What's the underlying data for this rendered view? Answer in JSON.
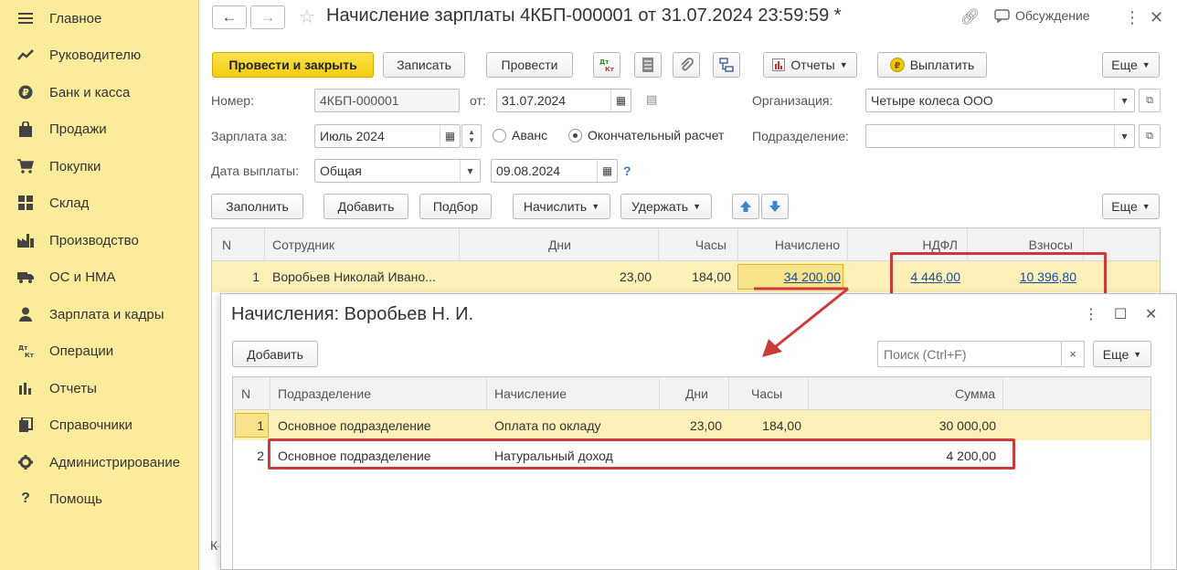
{
  "sidebar": {
    "items": [
      {
        "label": "Главное",
        "icon": "menu-icon"
      },
      {
        "label": "Руководителю",
        "icon": "trend-icon"
      },
      {
        "label": "Банк и касса",
        "icon": "ruble-coin-icon"
      },
      {
        "label": "Продажи",
        "icon": "shopping-bag-icon"
      },
      {
        "label": "Покупки",
        "icon": "cart-icon"
      },
      {
        "label": "Склад",
        "icon": "warehouse-icon"
      },
      {
        "label": "Производство",
        "icon": "factory-icon"
      },
      {
        "label": "ОС и НМА",
        "icon": "truck-icon"
      },
      {
        "label": "Зарплата и кадры",
        "icon": "person-icon"
      },
      {
        "label": "Операции",
        "icon": "dt-kt-icon"
      },
      {
        "label": "Отчеты",
        "icon": "bar-chart-icon"
      },
      {
        "label": "Справочники",
        "icon": "books-icon"
      },
      {
        "label": "Администрирование",
        "icon": "gear-icon"
      },
      {
        "label": "Помощь",
        "icon": "question-icon"
      }
    ]
  },
  "header": {
    "title": "Начисление зарплаты 4КБП-000001 от 31.07.2024 23:59:59 *",
    "discussion": "Обсуждение"
  },
  "toolbar": {
    "post_close": "Провести и закрыть",
    "save": "Записать",
    "post": "Провести",
    "dtkt": "Дт\nКт",
    "reports": "Отчеты",
    "pay": "Выплатить",
    "more": "Еще"
  },
  "form": {
    "number_label": "Номер:",
    "number_value": "4КБП-000001",
    "date_label": "от:",
    "date_value": "31.07.2024",
    "org_label": "Организация:",
    "org_value": "Четыре колеса ООО",
    "salary_for_label": "Зарплата за:",
    "salary_for_value": "Июль 2024",
    "advance_label": "Аванс",
    "final_label": "Окончательный расчет",
    "division_label": "Подразделение:",
    "division_value": "",
    "pay_date_label": "Дата выплаты:",
    "pay_type_value": "Общая",
    "pay_date_value": "09.08.2024",
    "help": "?"
  },
  "table_toolbar": {
    "fill": "Заполнить",
    "add": "Добавить",
    "pick": "Подбор",
    "accrue": "Начислить",
    "withhold": "Удержать",
    "more": "Еще"
  },
  "main_table": {
    "headers": {
      "n": "N",
      "employee": "Сотрудник",
      "days": "Дни",
      "hours": "Часы",
      "accrued": "Начислено",
      "ndfl": "НДФЛ",
      "contributions": "Взносы"
    },
    "rows": [
      {
        "n": "1",
        "employee": "Воробьев Николай Ивано...",
        "days": "23,00",
        "hours": "184,00",
        "accrued": "34 200,00",
        "ndfl": "4 446,00",
        "contributions": "10 396,80"
      }
    ],
    "bottom_cut_label": "К"
  },
  "popup": {
    "title": "Начисления: Воробьев Н. И.",
    "add": "Добавить",
    "search_placeholder": "Поиск (Ctrl+F)",
    "clear": "×",
    "more": "Еще",
    "headers": {
      "n": "N",
      "division": "Подразделение",
      "accrual": "Начисление",
      "days": "Дни",
      "hours": "Часы",
      "sum": "Сумма"
    },
    "rows": [
      {
        "n": "1",
        "division": "Основное подразделение",
        "accrual": "Оплата по окладу",
        "days": "23,00",
        "hours": "184,00",
        "sum": "30 000,00"
      },
      {
        "n": "2",
        "division": "Основное подразделение",
        "accrual": "Натуральный доход",
        "days": "",
        "hours": "",
        "sum": "4 200,00"
      }
    ]
  },
  "colors": {
    "sidebar_bg": "#fbec9c",
    "primary_button": "#f4cc11",
    "selected_row": "#fbf0b7",
    "highlight": "#cc3b3b",
    "link": "#1b4d9c"
  }
}
